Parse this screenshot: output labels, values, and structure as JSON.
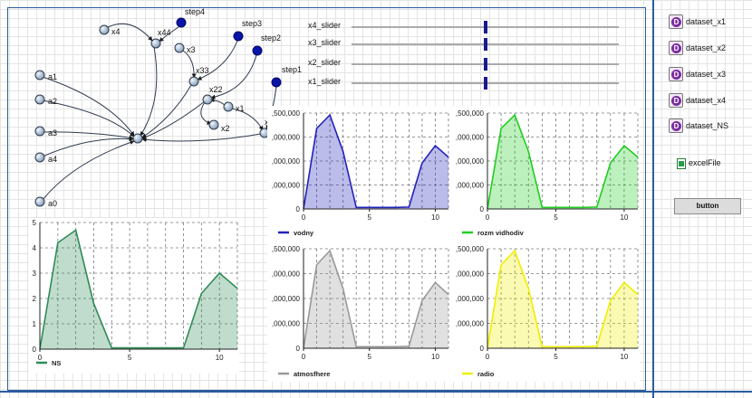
{
  "graph": {
    "nodes": [
      {
        "label": "x4"
      },
      {
        "label": "x44"
      },
      {
        "label": "step4"
      },
      {
        "label": "x3"
      },
      {
        "label": "step3"
      },
      {
        "label": "x33"
      },
      {
        "label": "step2"
      },
      {
        "label": "x22"
      },
      {
        "label": "x1"
      },
      {
        "label": "x2"
      },
      {
        "label": "x11"
      },
      {
        "label": "step1"
      },
      {
        "label": "a1"
      },
      {
        "label": "a2"
      },
      {
        "label": "a3"
      },
      {
        "label": "a4"
      },
      {
        "label": "a0"
      }
    ]
  },
  "sliders": [
    {
      "label": "x4_slider",
      "value": 0.5
    },
    {
      "label": "x3_slider",
      "value": 0.5
    },
    {
      "label": "x2_slider",
      "value": 0.5
    },
    {
      "label": "x1_slider",
      "value": 0.5
    }
  ],
  "datasets": [
    "dataset_x1",
    "dataset_x2",
    "dataset_x3",
    "dataset_x4",
    "dataset_NS"
  ],
  "excel": {
    "label": "excelFile"
  },
  "button": {
    "label": "button"
  },
  "colors": {
    "frame": "#2a5d9e",
    "NS": "#2e8b57",
    "vodny": "#2222bb",
    "rozm_vidhodiv": "#22cc22",
    "atmosfhere": "#999999",
    "radio": "#eeee00"
  },
  "chart_data": [
    {
      "type": "area",
      "series": [
        {
          "name": "NS",
          "color": "#2e8b57"
        }
      ],
      "x": [
        0,
        1,
        2,
        3,
        4,
        5,
        6,
        7,
        8,
        9,
        10,
        11
      ],
      "y": [
        0,
        4.2,
        4.7,
        1.8,
        0.05,
        0.05,
        0.05,
        0.05,
        0.05,
        2.2,
        3.0,
        2.4
      ],
      "xlim": [
        0,
        11
      ],
      "ylim": [
        0,
        5
      ],
      "yticks": [
        "0",
        "1",
        "2",
        "3",
        "4",
        "5"
      ],
      "xticks": [
        {
          "v": 0,
          "l": "0"
        },
        {
          "v": 5,
          "l": "5"
        },
        {
          "v": 10,
          "l": "10"
        }
      ],
      "vgrid": [
        1,
        2,
        3,
        4,
        5,
        6,
        7,
        8,
        9,
        10,
        11
      ],
      "grid": true,
      "legend": "bottom-left"
    },
    {
      "type": "area",
      "series": [
        {
          "name": "vodny",
          "color": "#2222bb"
        }
      ],
      "x": [
        0,
        1,
        2,
        3,
        4,
        5,
        6,
        7,
        8,
        9,
        10,
        11
      ],
      "y": [
        0,
        2100000,
        2450000,
        1500000,
        40000,
        40000,
        40000,
        40000,
        50000,
        1200000,
        1650000,
        1350000
      ],
      "xlim": [
        0,
        11
      ],
      "ylim": [
        0,
        2500000
      ],
      "yticks": [
        "0",
        ",000,000",
        ",000,000",
        ",000,000",
        ",500,000"
      ],
      "xticks": [
        {
          "v": 0,
          "l": "0"
        },
        {
          "v": 5,
          "l": "5"
        },
        {
          "v": 10,
          "l": "10"
        }
      ],
      "vgrid": [
        1,
        2,
        3,
        4,
        5,
        6,
        7,
        8,
        9,
        10,
        11
      ],
      "grid": true,
      "legend": "bottom-left"
    },
    {
      "type": "area",
      "series": [
        {
          "name": "rozm vidhodiv",
          "color": "#22cc22"
        }
      ],
      "x": [
        0,
        1,
        2,
        3,
        4,
        5,
        6,
        7,
        8,
        9,
        10,
        11
      ],
      "y": [
        0,
        2100000,
        2450000,
        1500000,
        40000,
        40000,
        40000,
        40000,
        50000,
        1200000,
        1650000,
        1350000
      ],
      "xlim": [
        0,
        11
      ],
      "ylim": [
        0,
        2500000
      ],
      "yticks": [
        "0",
        ",000,000",
        ",000,000",
        ",000,000",
        ",500,000"
      ],
      "xticks": [
        {
          "v": 0,
          "l": "0"
        },
        {
          "v": 5,
          "l": "5"
        },
        {
          "v": 10,
          "l": "10"
        }
      ],
      "vgrid": [
        1,
        2,
        3,
        4,
        5,
        6,
        7,
        8,
        9,
        10,
        11
      ],
      "grid": true,
      "legend": "bottom-left"
    },
    {
      "type": "area",
      "series": [
        {
          "name": "atmosfhere",
          "color": "#999999"
        }
      ],
      "x": [
        0,
        1,
        2,
        3,
        4,
        5,
        6,
        7,
        8,
        9,
        10,
        11
      ],
      "y": [
        0,
        2100000,
        2450000,
        1500000,
        40000,
        40000,
        40000,
        40000,
        50000,
        1200000,
        1650000,
        1350000
      ],
      "xlim": [
        0,
        11
      ],
      "ylim": [
        0,
        2500000
      ],
      "yticks": [
        "0",
        ",000,000",
        ",000,000",
        ",000,000",
        ",500,000"
      ],
      "xticks": [
        {
          "v": 0,
          "l": "0"
        },
        {
          "v": 5,
          "l": "5"
        },
        {
          "v": 10,
          "l": "10"
        }
      ],
      "vgrid": [
        1,
        2,
        3,
        4,
        5,
        6,
        7,
        8,
        9,
        10,
        11
      ],
      "grid": true,
      "legend": "bottom-left"
    },
    {
      "type": "area",
      "series": [
        {
          "name": "radio",
          "color": "#eeee00"
        }
      ],
      "x": [
        0,
        1,
        2,
        3,
        4,
        5,
        6,
        7,
        8,
        9,
        10,
        11
      ],
      "y": [
        0,
        2100000,
        2450000,
        1500000,
        40000,
        40000,
        40000,
        40000,
        50000,
        1200000,
        1650000,
        1350000
      ],
      "xlim": [
        0,
        11
      ],
      "ylim": [
        0,
        2500000
      ],
      "yticks": [
        "0",
        ",000,000",
        ",000,000",
        ",000,000",
        ",500,000"
      ],
      "xticks": [
        {
          "v": 0,
          "l": "0"
        },
        {
          "v": 5,
          "l": "5"
        },
        {
          "v": 10,
          "l": "10"
        }
      ],
      "vgrid": [
        1,
        2,
        3,
        4,
        5,
        6,
        7,
        8,
        9,
        10,
        11
      ],
      "grid": true,
      "legend": "bottom-left"
    }
  ]
}
